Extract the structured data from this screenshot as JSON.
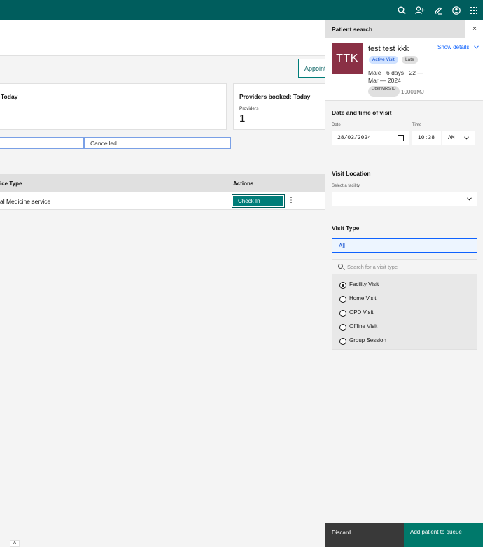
{
  "topbar": {
    "icons": [
      "search-icon",
      "add-user-icon",
      "pen-icon",
      "user-avatar-icon",
      "app-switcher-icon"
    ]
  },
  "background": {
    "appointments_button": "Appointments",
    "card_left_title": "Today",
    "card_right_title": "Providers booked: Today",
    "card_right_sublabel": "Providers",
    "card_right_count": "1",
    "tab_cancelled": "Cancelled",
    "table": {
      "headers": [
        "ice Type",
        "Actions"
      ],
      "row": {
        "service": "al Medicine service",
        "action": "Check In"
      }
    }
  },
  "panel": {
    "title": "Patient search",
    "close_label": "×",
    "patient": {
      "initials": "TTK",
      "name": "test test kkk",
      "show_details": "Show details",
      "tags": [
        "Active Visit",
        "Late"
      ],
      "meta": "Male · 6 days · 22 — Mar — 2024",
      "id_label": "OpenMRS ID",
      "id_value": "10001MJ",
      "avatar_color": "#8a3045"
    },
    "datetime": {
      "section": "Date and time of visit",
      "date_label": "Date",
      "date_value": "28/03/2024",
      "time_label": "Time",
      "time_value": "10:38",
      "ampm": "AM"
    },
    "location": {
      "section": "Visit Location",
      "select_label": "Select a facility",
      "selected": ""
    },
    "visit_type": {
      "section": "Visit Type",
      "filter": "All",
      "search_placeholder": "Search for a visit type",
      "options": [
        "Facility Visit",
        "Home Visit",
        "OPD Visit",
        "Offline Visit",
        "Group Session"
      ],
      "selected": "Facility Visit"
    },
    "footer": {
      "discard": "Discard",
      "add": "Add patient to queue"
    }
  },
  "colors": {
    "header": "#005d5d",
    "primary": "#00796b",
    "link": "#0f62fe"
  }
}
